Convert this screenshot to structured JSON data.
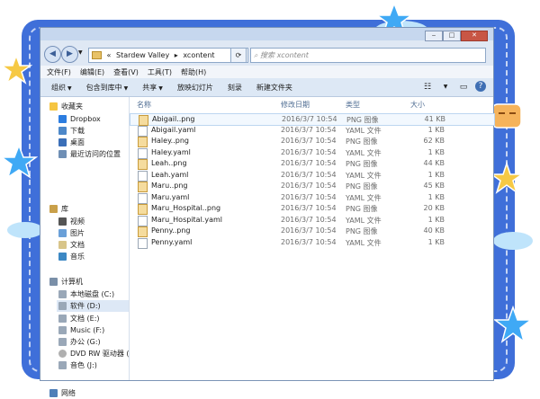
{
  "address": {
    "prefix": "«",
    "crumbs": [
      "Stardew Valley",
      "xcontent"
    ],
    "sep": "▸"
  },
  "search": {
    "placeholder": "搜索 xcontent"
  },
  "menu": [
    "文件(F)",
    "编辑(E)",
    "查看(V)",
    "工具(T)",
    "帮助(H)"
  ],
  "toolbar": {
    "organize": "组织",
    "include": "包含到库中",
    "share": "共享",
    "slideshow": "放映幻灯片",
    "burn": "刻录",
    "newfolder": "新建文件夹"
  },
  "sidebar": {
    "favorites": {
      "title": "收藏夹",
      "items": [
        "Dropbox",
        "下载",
        "桌面",
        "最近访问的位置"
      ]
    },
    "libraries": {
      "title": "库",
      "items": [
        "视频",
        "图片",
        "文档",
        "音乐"
      ]
    },
    "computer": {
      "title": "计算机",
      "items": [
        "本地磁盘 (C:)",
        "软件 (D:)",
        "文档 (E:)",
        "Music (F:)",
        "办公 (G:)",
        "DVD RW 驱动器 (H:",
        "音色 (J:)"
      ]
    },
    "network": {
      "title": "网络"
    }
  },
  "columns": {
    "name": "名称",
    "modified": "修改日期",
    "type": "类型",
    "size": "大小"
  },
  "files": [
    {
      "name": "Abigail..png",
      "date": "2016/3/7 10:54",
      "type": "PNG 图像",
      "size": "41 KB",
      "kind": "png"
    },
    {
      "name": "Abigail.yaml",
      "date": "2016/3/7 10:54",
      "type": "YAML 文件",
      "size": "1 KB",
      "kind": "yaml"
    },
    {
      "name": "Haley..png",
      "date": "2016/3/7 10:54",
      "type": "PNG 图像",
      "size": "62 KB",
      "kind": "png"
    },
    {
      "name": "Haley.yaml",
      "date": "2016/3/7 10:54",
      "type": "YAML 文件",
      "size": "1 KB",
      "kind": "yaml"
    },
    {
      "name": "Leah..png",
      "date": "2016/3/7 10:54",
      "type": "PNG 图像",
      "size": "44 KB",
      "kind": "png"
    },
    {
      "name": "Leah.yaml",
      "date": "2016/3/7 10:54",
      "type": "YAML 文件",
      "size": "1 KB",
      "kind": "yaml"
    },
    {
      "name": "Maru..png",
      "date": "2016/3/7 10:54",
      "type": "PNG 图像",
      "size": "45 KB",
      "kind": "png"
    },
    {
      "name": "Maru.yaml",
      "date": "2016/3/7 10:54",
      "type": "YAML 文件",
      "size": "1 KB",
      "kind": "yaml"
    },
    {
      "name": "Maru_Hospital..png",
      "date": "2016/3/7 10:54",
      "type": "PNG 图像",
      "size": "20 KB",
      "kind": "png"
    },
    {
      "name": "Maru_Hospital.yaml",
      "date": "2016/3/7 10:54",
      "type": "YAML 文件",
      "size": "1 KB",
      "kind": "yaml"
    },
    {
      "name": "Penny..png",
      "date": "2016/3/7 10:54",
      "type": "PNG 图像",
      "size": "40 KB",
      "kind": "png"
    },
    {
      "name": "Penny.yaml",
      "date": "2016/3/7 10:54",
      "type": "YAML 文件",
      "size": "1 KB",
      "kind": "yaml"
    }
  ],
  "icons": {
    "back": "back-arrow-icon",
    "forward": "forward-arrow-icon",
    "folder": "folder-icon",
    "search": "search-icon",
    "help": "help-icon"
  },
  "colors": {
    "frame": "#3f6fd9",
    "star": "#3fa9f5",
    "selected": "#f2f8fe"
  }
}
